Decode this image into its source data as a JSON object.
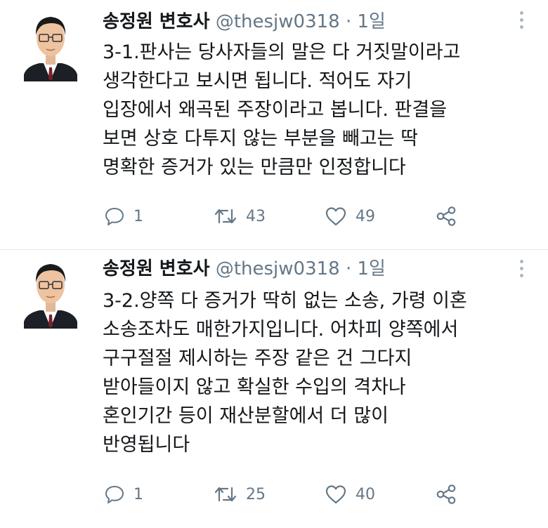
{
  "tweets": [
    {
      "author_name": "송정원 변호사",
      "handle": "@thesjw0318",
      "separator": "·",
      "time": "1일",
      "lines": [
        "3-1.판사는 당사자들의 말은 다 거짓말이라고",
        "생각한다고 보시면 됩니다. 적어도 자기",
        "입장에서 왜곡된 주장이라고 봅니다. 판결을",
        "보면 상호 다투지 않는 부분을 빼고는 딱",
        "명확한 증거가 있는 만큼만 인정합니다"
      ],
      "replies": "1",
      "retweets": "43",
      "likes": "49"
    },
    {
      "author_name": "송정원 변호사",
      "handle": "@thesjw0318",
      "separator": "·",
      "time": "1일",
      "lines": [
        "3-2.양쪽 다 증거가 딱히 없는 소송, 가령 이혼",
        "소송조차도 매한가지입니다. 어차피 양쪽에서",
        "구구절절  제시하는 주장 같은 건 그다지",
        "받아들이지 않고 확실한 수입의 격차나",
        "혼인기간 등이 재산분할에서 더 많이",
        "반영됩니다"
      ],
      "replies": "1",
      "retweets": "25",
      "likes": "40"
    }
  ],
  "icons": {
    "reply": "reply-icon",
    "retweet": "retweet-icon",
    "like": "heart-icon",
    "share": "share-icon",
    "more": "more-options-icon"
  },
  "colors": {
    "text": "#14171a",
    "secondary": "#657786",
    "icon": "#657786",
    "divider": "#e6ecf0"
  }
}
